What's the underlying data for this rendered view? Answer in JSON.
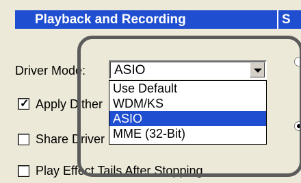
{
  "panel": {
    "title": "Playback and Recording",
    "right_header": "S"
  },
  "driver_mode": {
    "label": "Driver Mode:",
    "value": "ASIO",
    "options": [
      "Use Default",
      "WDM/KS",
      "ASIO",
      "MME (32-Bit)"
    ],
    "selected_index": 2
  },
  "checkboxes": {
    "apply_dither": {
      "label": "Apply Dither",
      "checked": true
    },
    "share_driver": {
      "label": "Share Driver",
      "checked": false
    },
    "play_effect_tails": {
      "label": "Play Effect Tails After Stopping",
      "checked": false
    }
  },
  "right_options": {
    "selected_index": 1
  }
}
